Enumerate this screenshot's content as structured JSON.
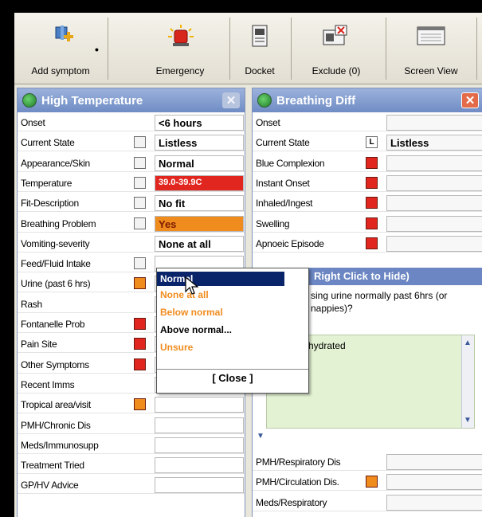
{
  "toolbar": {
    "add_symptom": "Add symptom",
    "emergency": "Emergency",
    "docket": "Docket",
    "exclude": "Exclude (0)",
    "screen_view": "Screen View"
  },
  "left_panel": {
    "title": "High Temperature",
    "rows": [
      {
        "label": "Onset",
        "value": "<6 hours",
        "box": "none"
      },
      {
        "label": "Current State",
        "value": "Listless",
        "box": "grey"
      },
      {
        "label": "Appearance/Skin",
        "value": "Normal",
        "box": "grey"
      },
      {
        "label": "Temperature",
        "value": "39.0-39.9C",
        "box": "grey",
        "value_style": "red"
      },
      {
        "label": "Fit-Description",
        "value": "No fit",
        "box": "grey"
      },
      {
        "label": "Breathing Problem",
        "value": "Yes",
        "box": "grey",
        "value_style": "orange"
      },
      {
        "label": "Vomiting-severity",
        "value": "None at all",
        "box": "none"
      },
      {
        "label": "Feed/Fluid Intake",
        "value": "",
        "box": "grey"
      },
      {
        "label": "Urine (past 6 hrs)",
        "value": "",
        "box": "orange"
      },
      {
        "label": "Rash",
        "value": "",
        "box": "none"
      },
      {
        "label": "Fontanelle Prob",
        "value": "",
        "box": "red"
      },
      {
        "label": "Pain Site",
        "value": "",
        "box": "red"
      },
      {
        "label": "Other Symptoms",
        "value": "",
        "box": "red"
      },
      {
        "label": "Recent Imms",
        "value": "",
        "box": "none"
      },
      {
        "label": "Tropical area/visit",
        "value": "",
        "box": "orange"
      },
      {
        "label": "PMH/Chronic Dis",
        "value": "",
        "box": "none"
      },
      {
        "label": "Meds/Immunosupp",
        "value": "",
        "box": "none"
      },
      {
        "label": "Treatment Tried",
        "value": "",
        "box": "none"
      },
      {
        "label": "GP/HV Advice",
        "value": "",
        "box": "none"
      }
    ]
  },
  "right_panel": {
    "title": "Breathing Diff",
    "current_state_marker": "L",
    "rows": [
      {
        "label": "Onset",
        "value": "",
        "box": "none"
      },
      {
        "label": "Current State",
        "value": "Listless",
        "box": "L"
      },
      {
        "label": "Blue Complexion",
        "value": "",
        "box": "red"
      },
      {
        "label": "Instant Onset",
        "value": "",
        "box": "red"
      },
      {
        "label": "Inhaled/Ingest",
        "value": "",
        "box": "red"
      },
      {
        "label": "Swelling",
        "value": "",
        "box": "red"
      },
      {
        "label": "Apnoeic Episode",
        "value": "",
        "box": "red"
      }
    ],
    "bottom_rows": [
      {
        "label": "PMH/Respiratory Dis",
        "value": "",
        "box": "none"
      },
      {
        "label": "PMH/Circulation Dis.",
        "value": "",
        "box": "orange"
      },
      {
        "label": "Meds/Respiratory",
        "value": "",
        "box": "none"
      }
    ]
  },
  "dropdown": {
    "options": [
      {
        "label": "Normal",
        "style": "selected"
      },
      {
        "label": "None at all",
        "style": "orange"
      },
      {
        "label": "Below normal",
        "style": "orange"
      },
      {
        "label": "Above normal...",
        "style": "black"
      },
      {
        "label": "Unsure",
        "style": "orange"
      }
    ],
    "close_label": "[ Close ]"
  },
  "popup": {
    "title": "Right Click to Hide)",
    "question": "sing urine normally past 6hrs (or",
    "question_line2": "nappies)?",
    "note_text": "hydrated"
  },
  "colors": {
    "red": "#e0261f",
    "orange": "#f08c1e",
    "grey_box": "#f3f3f3",
    "selected_bg": "#0a246a",
    "panel_title_blue": "#7b97cd",
    "note_bg": "#e4f2d4"
  }
}
